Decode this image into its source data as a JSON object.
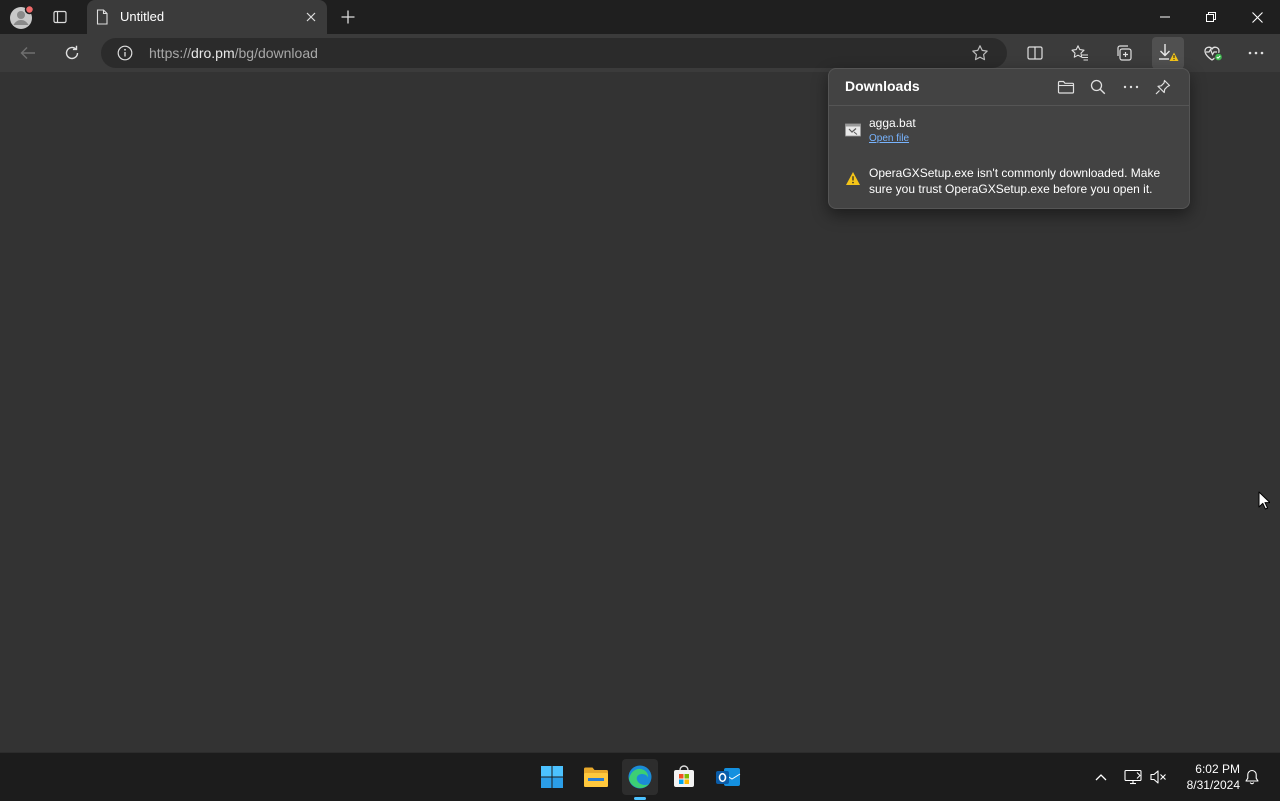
{
  "tab": {
    "title": "Untitled"
  },
  "address": {
    "scheme": "https://",
    "domain": "dro.pm",
    "path": "/bg/download"
  },
  "downloads_panel": {
    "title": "Downloads",
    "items": [
      {
        "filename": "agga.bat",
        "action": "Open file"
      }
    ],
    "warning": "OperaGXSetup.exe isn't commonly downloaded. Make sure you trust OperaGXSetup.exe before you open it."
  },
  "taskbar": {
    "apps": [
      "start-icon",
      "file-explorer-icon",
      "edge-icon",
      "store-icon",
      "outlook-icon"
    ],
    "clock": {
      "time": "6:02 PM",
      "date": "8/31/2024"
    }
  },
  "colors": {
    "accent": "#4cc2ff",
    "link": "#78b4ff",
    "warning": "#f5c518",
    "badge": "#3fb950"
  }
}
